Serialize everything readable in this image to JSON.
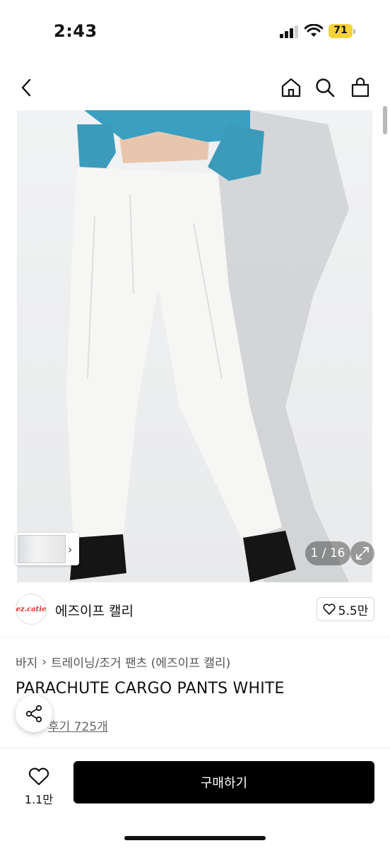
{
  "status_bar": {
    "time": "2:43",
    "battery_level": "71",
    "battery_color": "#f5d23a"
  },
  "header": {
    "icons": [
      "back-icon",
      "home-icon",
      "search-icon",
      "shopping-bag-icon"
    ]
  },
  "product_image": {
    "page_indicator": "1 / 16"
  },
  "brand": {
    "logo_text": "ez.catie",
    "name": "에즈이프 캘리",
    "like_count": "5.5만"
  },
  "product": {
    "breadcrumb": [
      "바지",
      "트레이닝/조거 팬츠 (에즈이프 캘리)"
    ],
    "title": "PARACHUTE CARGO PANTS WHITE",
    "review_link": "후기 725개"
  },
  "bottom_bar": {
    "wish_count": "1.1만",
    "buy_label": "구매하기",
    "buy_color": "#000000"
  }
}
